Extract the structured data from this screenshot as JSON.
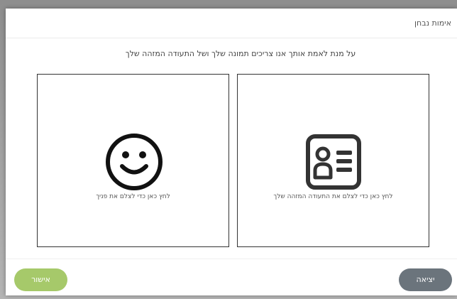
{
  "dialog": {
    "title": "אימות נבחן",
    "instruction": "על מנת לאמת אותך אנו צריכים תמונה שלך ושל התעודה המזהה שלך"
  },
  "cards": {
    "face": {
      "label": "לחץ כאן כדי לצלם את פניך",
      "icon": "smiley-face-icon"
    },
    "id": {
      "label": "לחץ כאן כדי לצלם את התעודה המזהה שלך",
      "icon": "id-card-icon"
    }
  },
  "footer": {
    "confirm_label": "אישור",
    "exit_label": "יציאה"
  },
  "colors": {
    "confirm": "#a6c96a",
    "exit": "#6b747c",
    "icon": "#333333"
  }
}
